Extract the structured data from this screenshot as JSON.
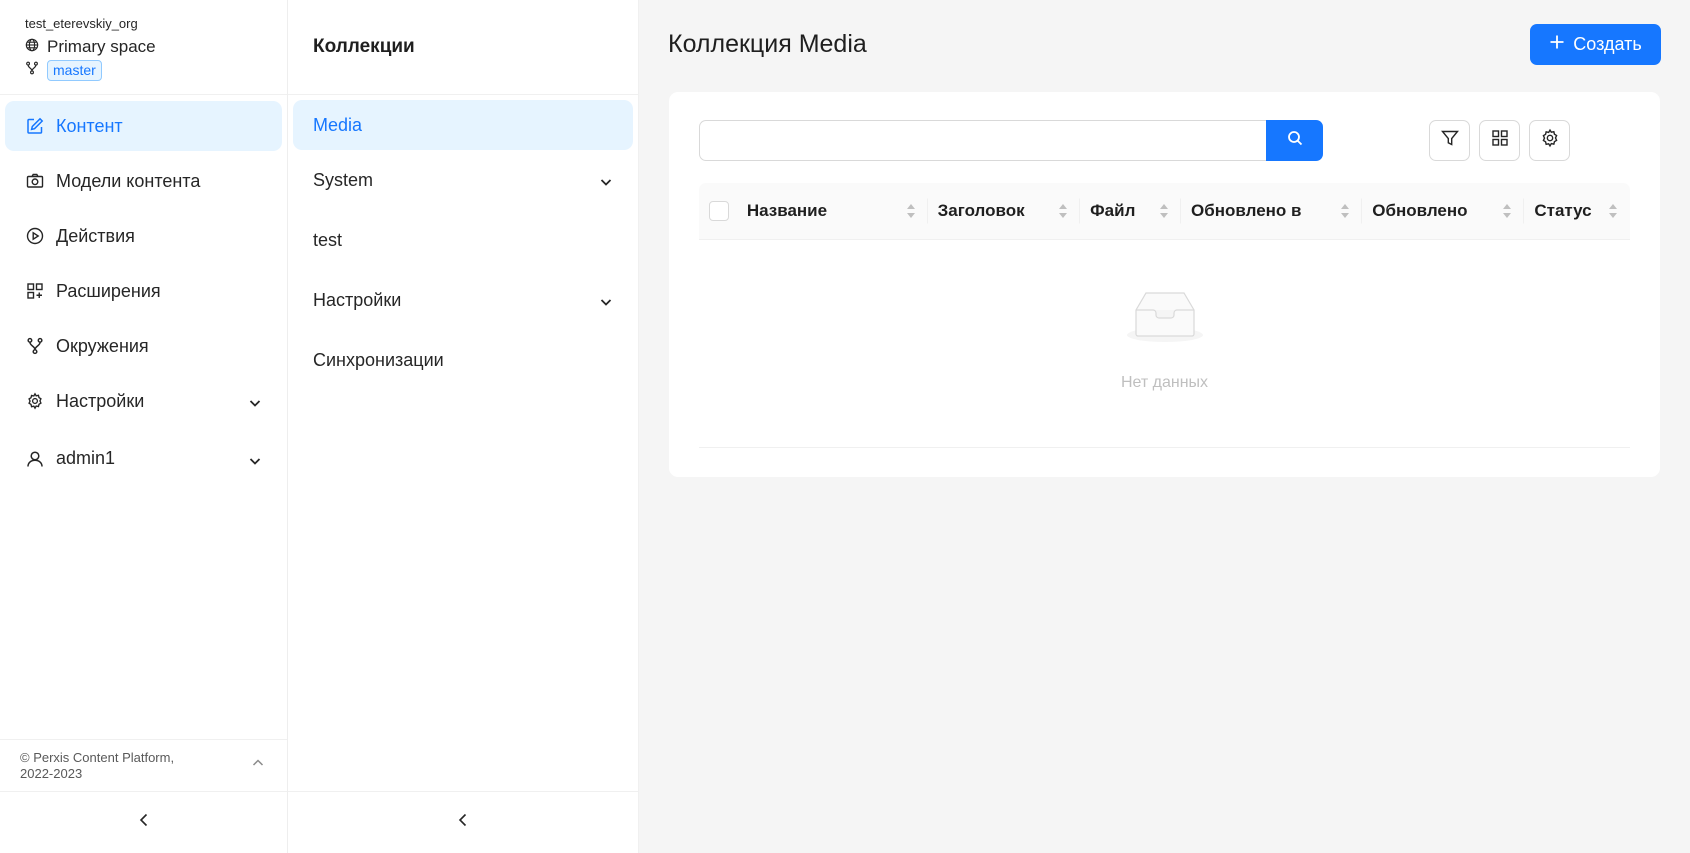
{
  "workspace": {
    "org": "test_eterevskiy_org",
    "space": "Primary space",
    "branch": "master"
  },
  "nav": {
    "items": [
      {
        "label": "Контент",
        "icon": "edit-icon",
        "active": true
      },
      {
        "label": "Модели контента",
        "icon": "camera-icon"
      },
      {
        "label": "Действия",
        "icon": "play-circle-icon"
      },
      {
        "label": "Расширения",
        "icon": "appstore-add-icon"
      },
      {
        "label": "Окружения",
        "icon": "branch-icon"
      },
      {
        "label": "Настройки",
        "icon": "gear-icon",
        "expandable": true
      },
      {
        "label": "admin1",
        "icon": "user-icon",
        "expandable": true
      }
    ],
    "footer": "© Perxis Content Platform, 2022-2023"
  },
  "collections": {
    "title": "Коллекции",
    "items": [
      {
        "label": "Media",
        "active": true
      },
      {
        "label": "System",
        "expandable": true
      },
      {
        "label": "test"
      },
      {
        "label": "Настройки",
        "expandable": true
      },
      {
        "label": "Синхронизации"
      }
    ]
  },
  "main": {
    "title": "Коллекция Media",
    "create_label": "Создать",
    "search": {
      "value": "",
      "placeholder": ""
    },
    "columns": [
      "Название",
      "Заголовок",
      "Файл",
      "Обновлено в",
      "Обновлено",
      "Статус"
    ],
    "empty_text": "Нет данных"
  },
  "colors": {
    "primary": "#1677ff",
    "active_bg": "#e6f4ff"
  }
}
